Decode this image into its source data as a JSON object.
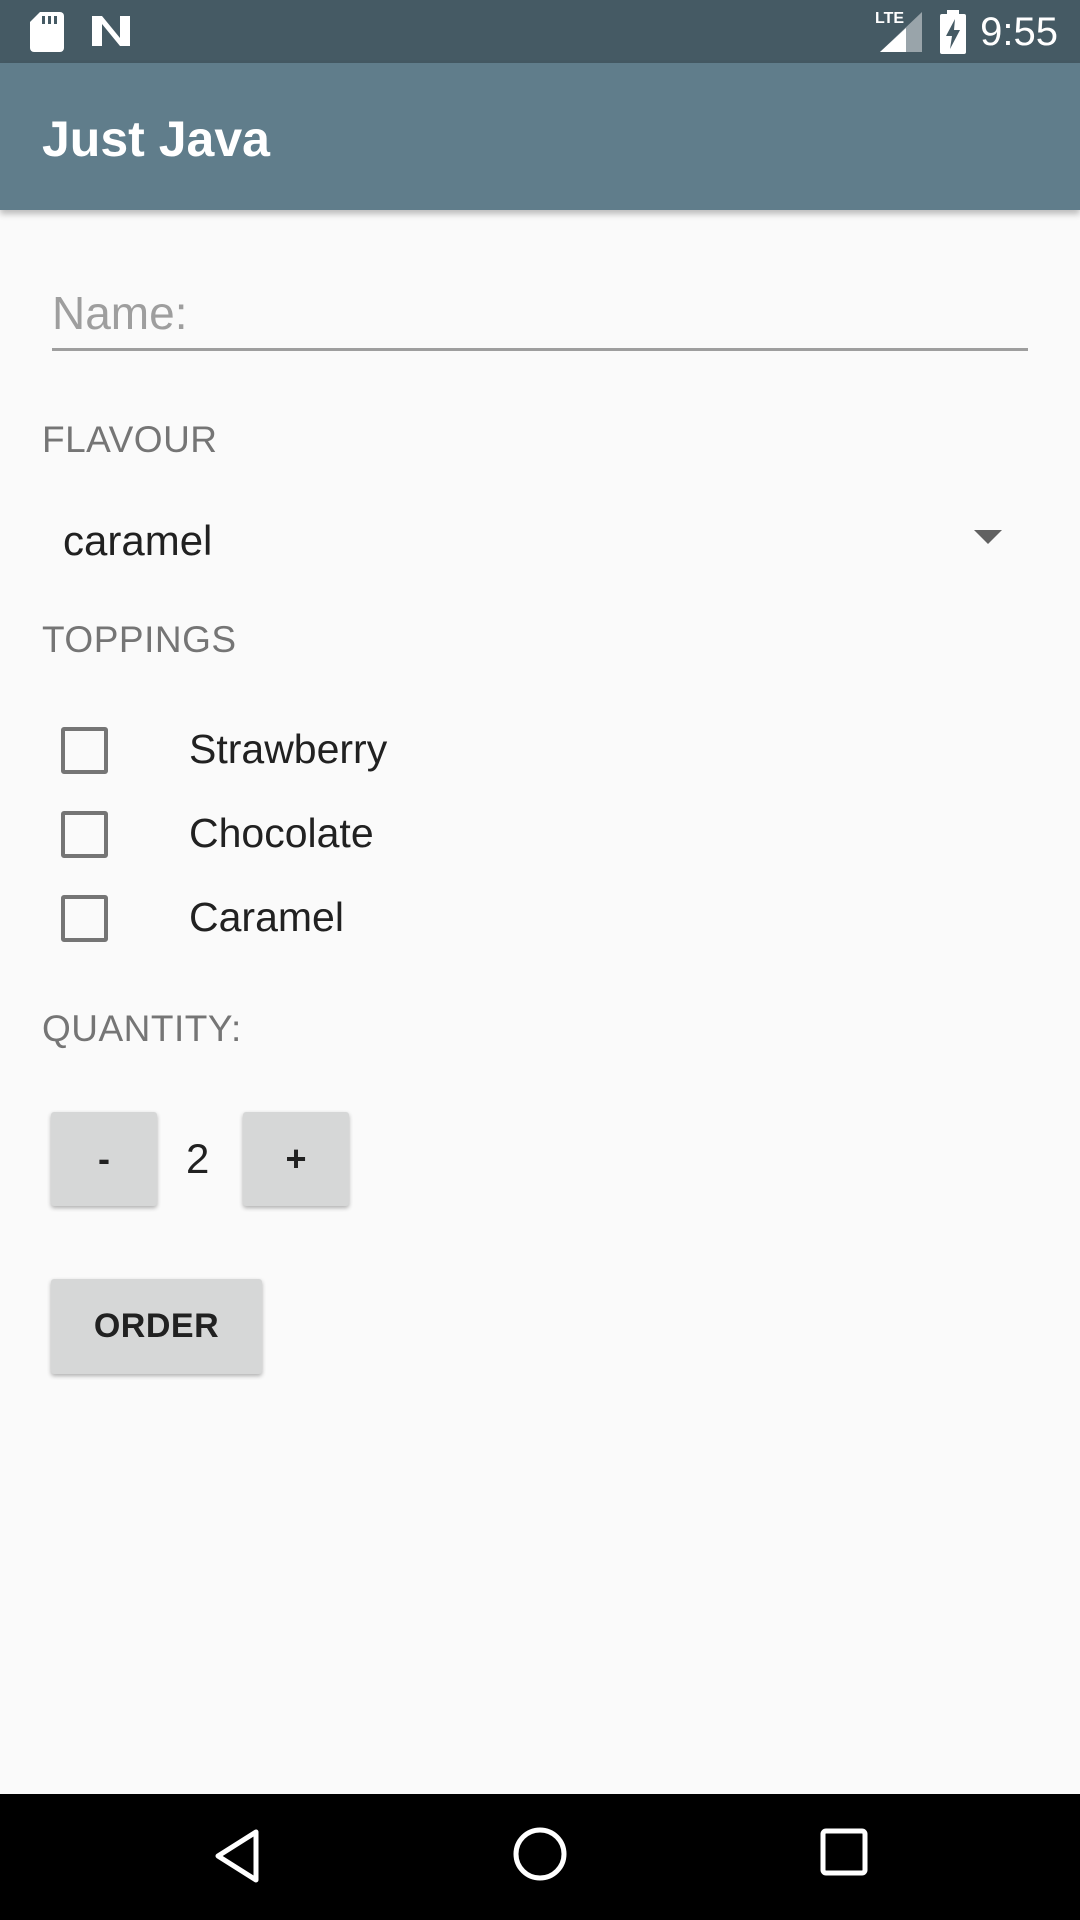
{
  "status_bar": {
    "time": "9:55",
    "network_label": "LTE",
    "icons": [
      "sd-card-icon",
      "n-logo-icon",
      "signal-icon",
      "battery-charging-icon"
    ]
  },
  "app_bar": {
    "title": "Just Java"
  },
  "form": {
    "name_placeholder": "Name:",
    "name_value": "",
    "flavour_label": "FLAVOUR",
    "flavour_selected": "caramel",
    "toppings_label": "TOPPINGS",
    "toppings": [
      {
        "label": "Strawberry",
        "checked": false
      },
      {
        "label": "Chocolate",
        "checked": false
      },
      {
        "label": "Caramel",
        "checked": false
      }
    ],
    "quantity_label": "QUANTITY:",
    "decrement_label": "-",
    "quantity_value": "2",
    "increment_label": "+",
    "order_label": "ORDER"
  },
  "nav_bar": {
    "icons": [
      "back-icon",
      "home-icon",
      "recents-icon"
    ]
  },
  "colors": {
    "status_bar": "#455a64",
    "app_bar": "#607d8b",
    "background": "#fafafa",
    "button": "#d6d7d7"
  }
}
